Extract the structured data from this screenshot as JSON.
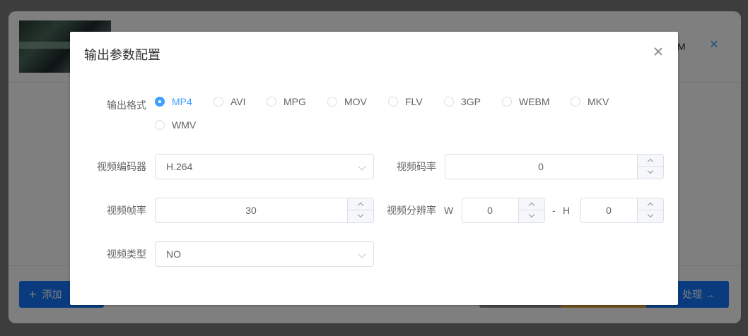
{
  "background": {
    "filename_tail": "M",
    "add_button_label": "添加",
    "start_button_label": "处理 →"
  },
  "dialog": {
    "title": "输出参数配置",
    "format": {
      "label": "输出格式",
      "options": [
        "MP4",
        "AVI",
        "MPG",
        "MOV",
        "FLV",
        "3GP",
        "WEBM",
        "MKV",
        "WMV"
      ],
      "selected": "MP4"
    },
    "video_codec": {
      "label": "视频编码器",
      "value": "H.264"
    },
    "video_bitrate": {
      "label": "视频码率",
      "value": "0"
    },
    "video_framerate": {
      "label": "视频帧率",
      "value": "30"
    },
    "video_resolution": {
      "label": "视频分辨率",
      "w_label": "W",
      "w_value": "0",
      "separator": "-",
      "h_label": "H",
      "h_value": "0"
    },
    "video_type": {
      "label": "视频类型",
      "value": "NO"
    }
  },
  "colors": {
    "accent": "#409eff",
    "primary_button": "#1677ff"
  }
}
